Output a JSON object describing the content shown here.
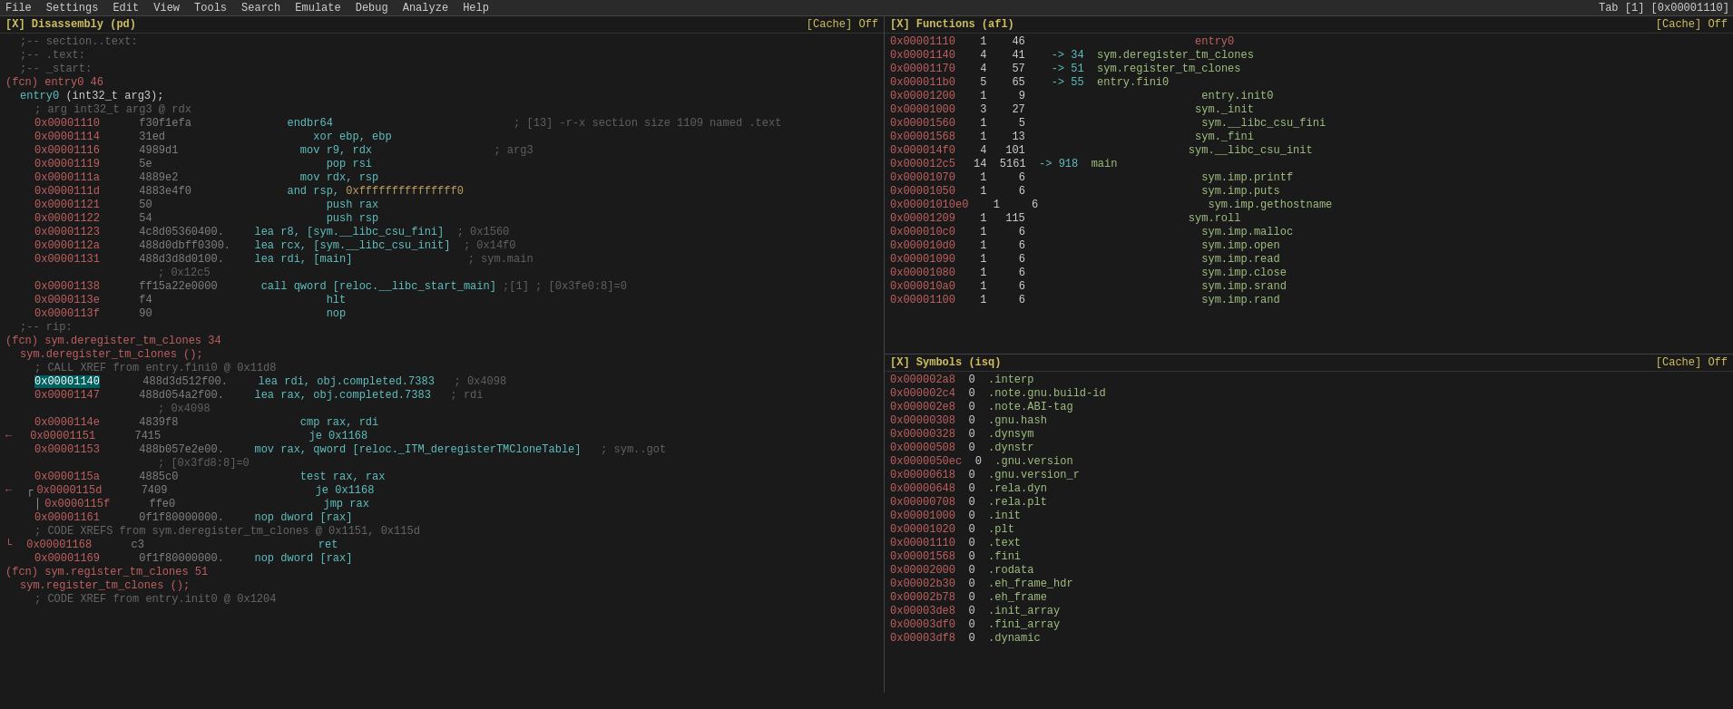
{
  "menu": {
    "items": [
      "File",
      "Settings",
      "Edit",
      "View",
      "Tools",
      "Search",
      "Emulate",
      "Debug",
      "Analyze",
      "Help"
    ],
    "tab": "Tab [1] [0x00001110]"
  },
  "disassembly": {
    "title": "[X] Disassembly (pd)",
    "cache": "[Cache] Off",
    "lines": []
  },
  "functions": {
    "title": "[X] Functions (afl)",
    "cache": "[Cache] Off"
  },
  "symbols": {
    "title": "[X] Symbols (isq)",
    "cache": "[Cache] Off"
  }
}
